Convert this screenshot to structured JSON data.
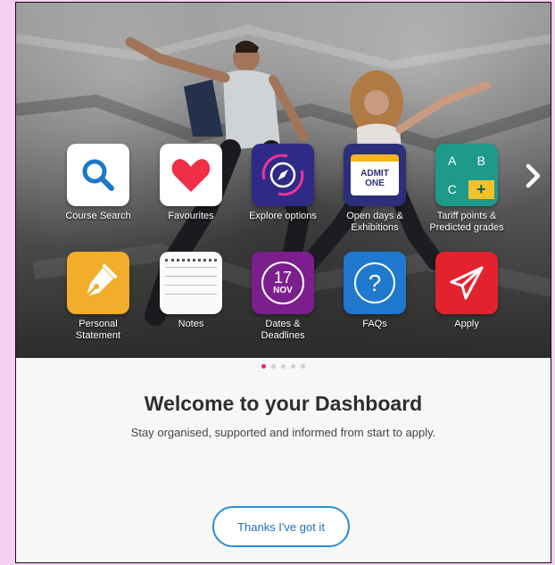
{
  "colors": {
    "accent": "#2b8fd6",
    "active_dot": "#e8256a",
    "pink_border": "#f6d0f4"
  },
  "tiles": [
    {
      "label": "Course Search",
      "icon": "search-icon"
    },
    {
      "label": "Favourites",
      "icon": "heart-icon"
    },
    {
      "label": "Explore options",
      "icon": "compass-icon"
    },
    {
      "label": "Open days & Exhibitions",
      "icon": "admit-one-ticket-icon",
      "ticket_text_1": "ADMIT",
      "ticket_text_2": "ONE"
    },
    {
      "label": "Tariff points & Predicted grades",
      "icon": "calculator-grid-icon",
      "cells": [
        "A",
        "B",
        "C",
        "+"
      ]
    },
    {
      "label": "Personal Statement",
      "icon": "fountain-pen-icon"
    },
    {
      "label": "Notes",
      "icon": "notepad-icon"
    },
    {
      "label": "Dates & Deadlines",
      "icon": "calendar-icon",
      "day": "17",
      "month": "NOV"
    },
    {
      "label": "FAQs",
      "icon": "question-icon",
      "glyph": "?"
    },
    {
      "label": "Apply",
      "icon": "paper-plane-icon"
    }
  ],
  "carousel": {
    "pages": 5,
    "active_page": 1
  },
  "welcome": {
    "title": "Welcome to your Dashboard",
    "subtitle": "Stay organised, supported and informed from start to apply."
  },
  "cta": {
    "label": "Thanks I've got it"
  }
}
